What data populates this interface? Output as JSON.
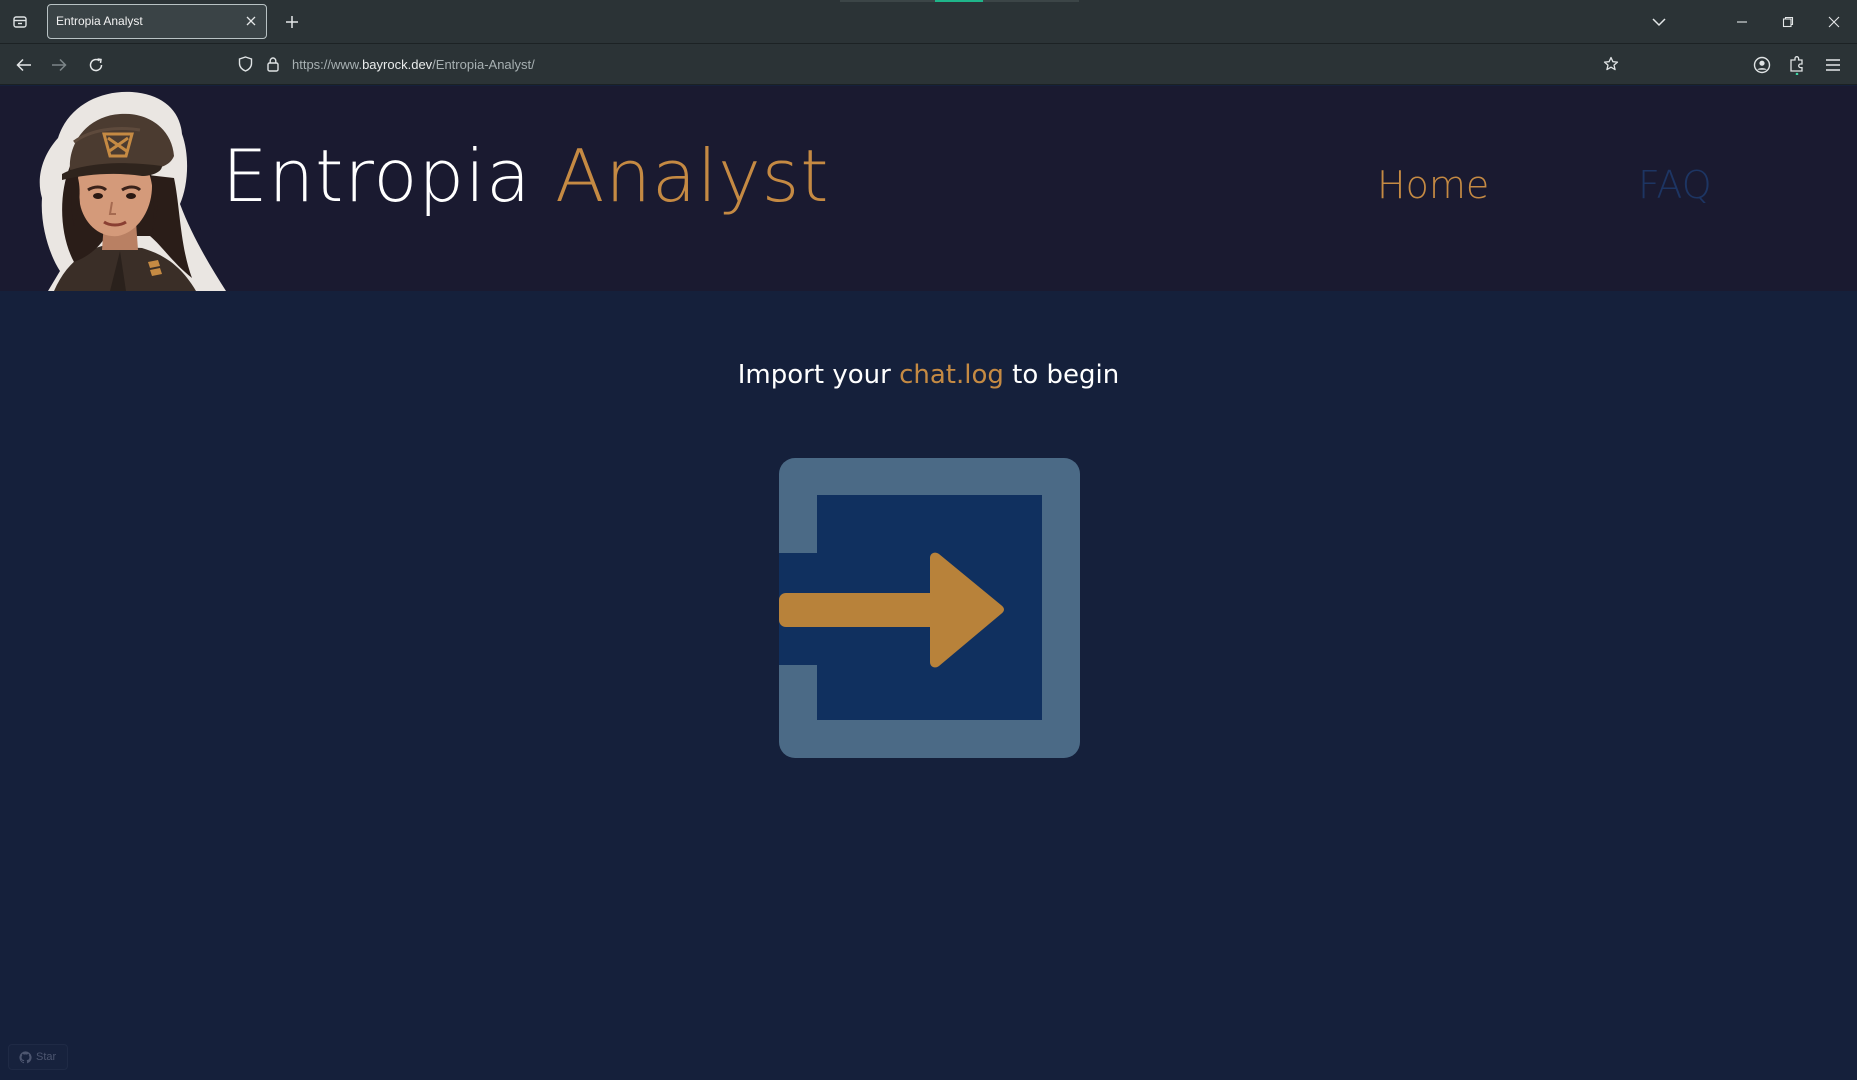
{
  "browser": {
    "tab_title": "Entropia Analyst",
    "url_prefix": "https://www.",
    "url_host": "bayrock.dev",
    "url_path": "/Entropia-Analyst/"
  },
  "site": {
    "title_main": "Entropia",
    "title_accent": "Analyst",
    "nav": {
      "home": "Home",
      "faq": "FAQ"
    }
  },
  "main": {
    "heading_before": "Import your",
    "heading_accent": "chat.log",
    "heading_after": "to begin"
  },
  "footer": {
    "star_label": "Star"
  },
  "colors": {
    "page_bg": "#15203b",
    "header_bg": "#1a1a30",
    "accent": "#c58a43",
    "import_frame": "#4b6a86",
    "import_inner": "#10305f",
    "faq_link": "#1d3563"
  }
}
